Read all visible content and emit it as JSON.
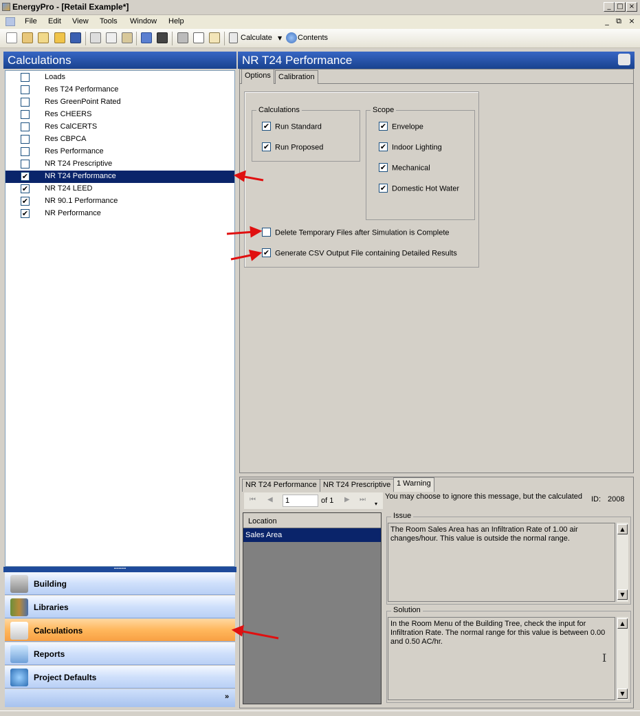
{
  "window": {
    "title": "EnergyPro - [Retail Example*]",
    "controls": [
      "_",
      "□",
      "×"
    ],
    "mdi_controls": [
      "_",
      "⧉",
      "×"
    ]
  },
  "menu": [
    "File",
    "Edit",
    "View",
    "Tools",
    "Window",
    "Help"
  ],
  "toolbar": {
    "calculate_label": "Calculate",
    "contents_label": "Contents"
  },
  "left_panel": {
    "title": "Calculations",
    "items": [
      {
        "label": "Loads",
        "checked": false,
        "selected": false
      },
      {
        "label": "Res T24 Performance",
        "checked": false,
        "selected": false
      },
      {
        "label": "Res GreenPoint Rated",
        "checked": false,
        "selected": false
      },
      {
        "label": "Res CHEERS",
        "checked": false,
        "selected": false
      },
      {
        "label": "Res CalCERTS",
        "checked": false,
        "selected": false
      },
      {
        "label": "Res CBPCA",
        "checked": false,
        "selected": false
      },
      {
        "label": "Res Performance",
        "checked": false,
        "selected": false
      },
      {
        "label": "NR T24 Prescriptive",
        "checked": false,
        "selected": false
      },
      {
        "label": "NR T24 Performance",
        "checked": true,
        "selected": true
      },
      {
        "label": "NR T24 LEED",
        "checked": true,
        "selected": false
      },
      {
        "label": "NR 90.1 Performance",
        "checked": true,
        "selected": false
      },
      {
        "label": "NR Performance",
        "checked": true,
        "selected": false
      }
    ],
    "grip": "••••••••••"
  },
  "nav": [
    {
      "label": "Building",
      "icon": "building-icon",
      "active": false
    },
    {
      "label": "Libraries",
      "icon": "libraries-icon",
      "active": false
    },
    {
      "label": "Calculations",
      "icon": "calculations-icon",
      "active": true
    },
    {
      "label": "Reports",
      "icon": "reports-icon",
      "active": false
    },
    {
      "label": "Project Defaults",
      "icon": "gear-icon",
      "active": false
    }
  ],
  "nav_more": "»",
  "right_panel": {
    "title": "NR T24 Performance",
    "tabs": [
      "Options",
      "Calibration"
    ],
    "calculations_group": {
      "label": "Calculations",
      "options": [
        {
          "label": "Run Standard",
          "checked": true
        },
        {
          "label": "Run Proposed",
          "checked": true
        }
      ]
    },
    "scope_group": {
      "label": "Scope",
      "options": [
        {
          "label": "Envelope",
          "checked": true
        },
        {
          "label": "Indoor Lighting",
          "checked": true
        },
        {
          "label": "Mechanical",
          "checked": true
        },
        {
          "label": "Domestic Hot Water",
          "checked": true
        }
      ]
    },
    "delete_temp": {
      "label": "Delete Temporary Files after Simulation is Complete",
      "checked": false
    },
    "generate_csv": {
      "label": "Generate CSV Output File containing Detailed Results",
      "checked": true
    }
  },
  "bottom_panel": {
    "tabs": [
      "NR T24 Performance",
      "NR T24 Prescriptive",
      "1 Warning"
    ],
    "pager": {
      "current": "1",
      "of_label": "of 1"
    },
    "message": "You may choose to ignore this message, but the calculated",
    "id_label": "ID:",
    "id_value": "2008",
    "location_header": "Location",
    "location_row": "Sales Area",
    "issue_label": "Issue",
    "issue_text": "The Room Sales Area has an Infiltration Rate of 1.00 air changes/hour.  This value is outside the normal range.",
    "solution_label": "Solution",
    "solution_text": "In the Room Menu of the Building Tree, check the input for Infiltration Rate.  The normal range for this value is between 0.00 and 0.50 AC/hr."
  }
}
